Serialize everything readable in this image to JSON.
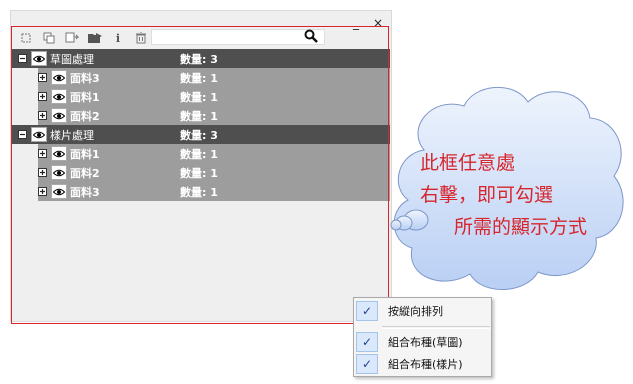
{
  "window": {
    "minimize_label": "_",
    "close_label": "×"
  },
  "toolbar": {
    "icons": [
      "new-layer-icon",
      "duplicate-icon",
      "copy-icon",
      "folder-icon",
      "info-icon",
      "delete-icon"
    ],
    "info_label": "i"
  },
  "search": {
    "placeholder": "",
    "value": ""
  },
  "tree": {
    "groups": [
      {
        "label": "草圖處理",
        "count": "數量: 3",
        "expander": "⊟",
        "children": [
          {
            "label": "面料3",
            "count": "數量: 1",
            "expander": "⊞"
          },
          {
            "label": "面料1",
            "count": "數量: 1",
            "expander": "⊞"
          },
          {
            "label": "面料2",
            "count": "數量: 1",
            "expander": "⊞"
          }
        ]
      },
      {
        "label": "樣片處理",
        "count": "數量: 3",
        "expander": "⊟",
        "children": [
          {
            "label": "面料1",
            "count": "數量: 1",
            "expander": "⊞"
          },
          {
            "label": "面料2",
            "count": "數量: 1",
            "expander": "⊞"
          },
          {
            "label": "面料3",
            "count": "數量: 1",
            "expander": "⊞"
          }
        ]
      }
    ]
  },
  "callout": {
    "line1": "此框任意處",
    "line2": "右擊，即可勾選",
    "line3": "所需的顯示方式"
  },
  "context_menu": {
    "items": [
      {
        "label": "按縱向排列",
        "checked": "✓"
      },
      {
        "label": "組合布種(草圖)",
        "checked": "✓"
      },
      {
        "label": "組合布種(樣片)",
        "checked": "✓"
      }
    ]
  },
  "colors": {
    "group_row": "#4f4f4f",
    "child_row": "#9d9d9d",
    "frame": "#d9232d",
    "callout_text": "#d7262c",
    "cloud_fill": "#dbe7fb"
  }
}
